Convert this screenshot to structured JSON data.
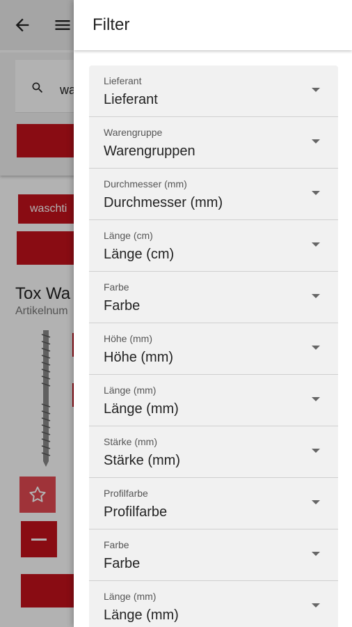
{
  "background_page": {
    "search_value": "wa",
    "chip_label": "waschti",
    "product_title": "Tox Wa",
    "product_subtitle": "Artikelnum"
  },
  "drawer": {
    "title": "Filter",
    "filters": [
      {
        "label": "Lieferant",
        "value": "Lieferant"
      },
      {
        "label": "Warengruppe",
        "value": "Warengruppen"
      },
      {
        "label": "Durchmesser (mm)",
        "value": "Durchmesser (mm)"
      },
      {
        "label": "Länge (cm)",
        "value": "Länge (cm)"
      },
      {
        "label": "Farbe",
        "value": "Farbe"
      },
      {
        "label": "Höhe (mm)",
        "value": "Höhe (mm)"
      },
      {
        "label": "Länge (mm)",
        "value": "Länge (mm)"
      },
      {
        "label": "Stärke (mm)",
        "value": "Stärke (mm)"
      },
      {
        "label": "Profilfarbe",
        "value": "Profilfarbe"
      },
      {
        "label": "Farbe",
        "value": "Farbe"
      },
      {
        "label": "Länge (mm)",
        "value": "Länge (mm)"
      }
    ]
  },
  "icons": {
    "back": "arrow-back-icon",
    "menu": "hamburger-menu-icon",
    "search": "search-icon",
    "favorite": "star-outline-icon",
    "decrease": "minus-icon",
    "dropdown": "dropdown-arrow-icon"
  },
  "colors": {
    "accent": "#c4121c",
    "field_background": "#f1f1f1",
    "drawer_background": "#ffffff"
  }
}
